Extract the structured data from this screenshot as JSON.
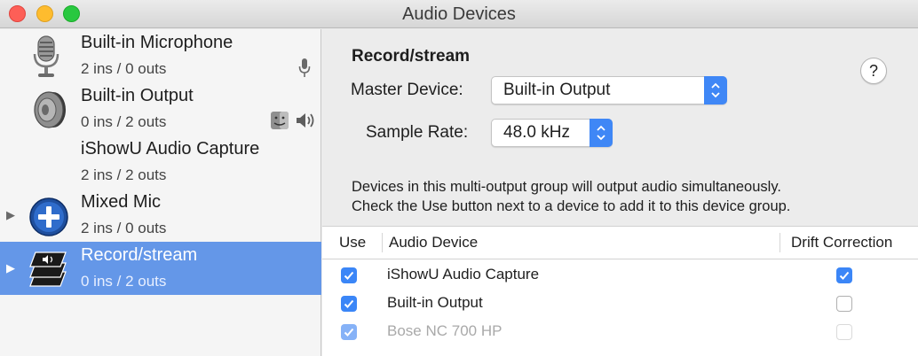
{
  "window": {
    "title": "Audio Devices"
  },
  "sidebar": {
    "items": [
      {
        "name": "Built-in Microphone",
        "io": "2 ins / 0 outs",
        "icon": "microphone-icon",
        "badges": [
          "mic-input-icon"
        ]
      },
      {
        "name": "Built-in Output",
        "io": "0 ins / 2 outs",
        "icon": "speaker-icon",
        "badges": [
          "finder-icon",
          "speaker-output-icon"
        ]
      },
      {
        "name": "iShowU Audio Capture",
        "io": "2 ins / 2 outs",
        "icon": "none"
      },
      {
        "name": "Mixed Mic",
        "io": "2 ins / 0 outs",
        "icon": "aggregate-device-plus-icon",
        "expandable": true
      },
      {
        "name": "Record/stream",
        "io": "0 ins / 2 outs",
        "icon": "multi-output-stack-icon",
        "expandable": true,
        "selected": true
      }
    ]
  },
  "main": {
    "group_title": "Record/stream",
    "help_label": "?",
    "master_device_label": "Master Device:",
    "master_device_value": "Built-in Output",
    "sample_rate_label": "Sample Rate:",
    "sample_rate_value": "48.0 kHz",
    "description_line1": "Devices in this multi-output group will output audio simultaneously.",
    "description_line2": "Check the Use button next to a device to add it to this device group."
  },
  "table": {
    "headers": {
      "use": "Use",
      "device": "Audio Device",
      "drift": "Drift Correction"
    },
    "rows": [
      {
        "use": true,
        "device": "iShowU Audio Capture",
        "drift": true,
        "enabled": true
      },
      {
        "use": true,
        "device": "Built-in Output",
        "drift": false,
        "enabled": true
      },
      {
        "use": true,
        "device": "Bose NC 700 HP",
        "drift": false,
        "enabled": false
      }
    ]
  },
  "colors": {
    "selection": "#6497e8",
    "accent": "#3b86f7",
    "sidebar_bg": "#f5f5f5",
    "panel_bg": "#ececec"
  }
}
